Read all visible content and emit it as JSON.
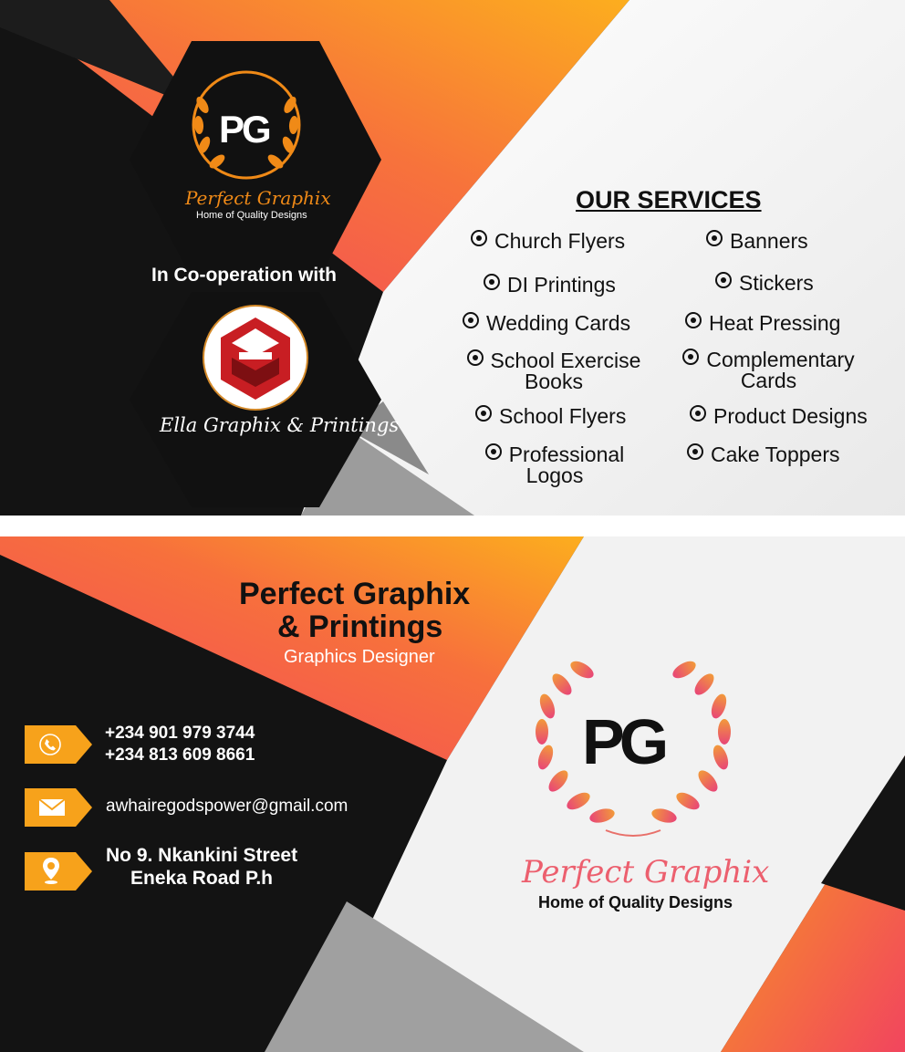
{
  "front": {
    "logo_mark": "PG",
    "logo_script": "Perfect Graphix",
    "logo_tagline": "Home of Quality Designs",
    "cooperation": "In Co-operation with",
    "partner_name": "Ella Graphix & Printings",
    "services_title": "OUR SERVICES",
    "services_left": [
      "Church Flyers",
      "DI Printings",
      "Wedding Cards",
      "School Exercise Books",
      "School Flyers",
      "Professional Logos"
    ],
    "services_right": [
      "Banners",
      "Stickers",
      "Heat Pressing",
      "Complementary Cards",
      "Product Designs",
      "Cake Toppers"
    ]
  },
  "back": {
    "company_line1": "Perfect Graphix",
    "company_line2": "& Printings",
    "role": "Graphics Designer",
    "phone1": "+234 901 979 3744",
    "phone2": "+234 813 609 8661",
    "email": "awhairegodspower@gmail.com",
    "address_line1": "No 9. Nkankini Street",
    "address_line2": "Eneka Road P.h",
    "logo_mark": "PG",
    "logo_script": "Perfect Graphix",
    "logo_tagline": "Home of Quality Designs"
  },
  "icons": [
    "phone-icon",
    "mail-icon",
    "location-pin-icon",
    "laurel-wreath-icon",
    "service-bullet-icon"
  ],
  "colors": {
    "orange": "#f7a21b",
    "coral": "#f2545b",
    "black": "#131313",
    "light": "#f0f0f0",
    "gray": "#9b9b9b"
  }
}
